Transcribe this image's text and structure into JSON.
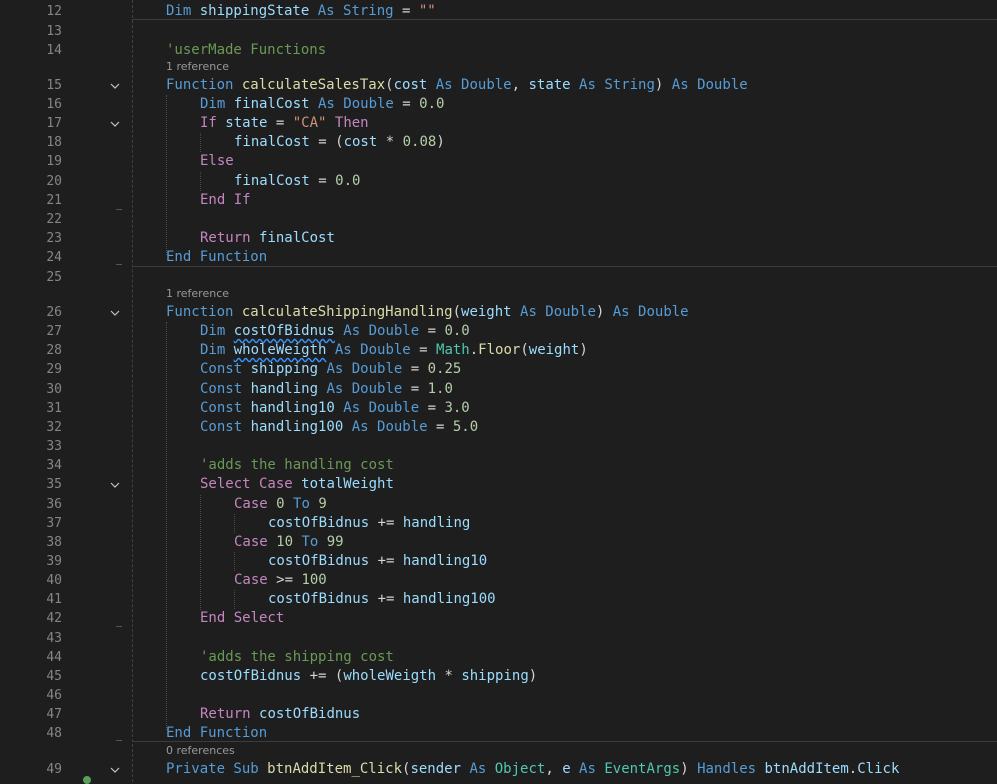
{
  "editor": {
    "colors": {
      "background": "#1e1e1e",
      "line_number": "#858585",
      "keyword": "#569cd6",
      "control": "#c586c0",
      "function": "#dcdcaa",
      "variable": "#9cdcfe",
      "string": "#ce9178",
      "number": "#b5cea8",
      "comment": "#6a9955",
      "type": "#4ec9b0"
    },
    "lenses": {
      "l15": "1 reference",
      "l26": "1 reference",
      "l49": "0 references"
    },
    "fold_icon": "chevron-down-icon",
    "lines": [
      {
        "n": "12",
        "tokens": [
          {
            "c": "kw",
            "t": "Dim "
          },
          {
            "c": "var",
            "t": "shippingState"
          },
          {
            "c": "kw",
            "t": " As String "
          },
          {
            "c": "",
            "t": "= "
          },
          {
            "c": "str",
            "t": "\"\""
          }
        ]
      },
      {
        "n": "13",
        "tokens": []
      },
      {
        "n": "14",
        "tokens": [
          {
            "c": "com",
            "t": "'userMade Functions"
          }
        ]
      },
      {
        "n": "15",
        "tokens": [
          {
            "c": "kw",
            "t": "Function "
          },
          {
            "c": "fn",
            "t": "calculateSalesTax"
          },
          {
            "c": "",
            "t": "("
          },
          {
            "c": "var",
            "t": "cost"
          },
          {
            "c": "kw",
            "t": " As Double"
          },
          {
            "c": "",
            "t": ", "
          },
          {
            "c": "var",
            "t": "state"
          },
          {
            "c": "kw",
            "t": " As String"
          },
          {
            "c": "",
            "t": ") "
          },
          {
            "c": "kw",
            "t": "As Double"
          }
        ]
      },
      {
        "n": "16",
        "tokens": [
          {
            "c": "kw",
            "t": "Dim "
          },
          {
            "c": "var",
            "t": "finalCost"
          },
          {
            "c": "kw",
            "t": " As Double "
          },
          {
            "c": "",
            "t": "= "
          },
          {
            "c": "num",
            "t": "0.0"
          }
        ]
      },
      {
        "n": "17",
        "tokens": [
          {
            "c": "ctl",
            "t": "If "
          },
          {
            "c": "var",
            "t": "state"
          },
          {
            "c": "",
            "t": " = "
          },
          {
            "c": "str",
            "t": "\"CA\""
          },
          {
            "c": "ctl",
            "t": " Then"
          }
        ]
      },
      {
        "n": "18",
        "tokens": [
          {
            "c": "var",
            "t": "finalCost"
          },
          {
            "c": "",
            "t": " = ("
          },
          {
            "c": "var",
            "t": "cost"
          },
          {
            "c": "",
            "t": " * "
          },
          {
            "c": "num",
            "t": "0.08"
          },
          {
            "c": "",
            "t": ")"
          }
        ]
      },
      {
        "n": "19",
        "tokens": [
          {
            "c": "ctl",
            "t": "Else"
          }
        ]
      },
      {
        "n": "20",
        "tokens": [
          {
            "c": "var",
            "t": "finalCost"
          },
          {
            "c": "",
            "t": " = "
          },
          {
            "c": "num",
            "t": "0.0"
          }
        ]
      },
      {
        "n": "21",
        "tokens": [
          {
            "c": "ctl",
            "t": "End If"
          }
        ]
      },
      {
        "n": "22",
        "tokens": []
      },
      {
        "n": "23",
        "tokens": [
          {
            "c": "ctl",
            "t": "Return "
          },
          {
            "c": "var",
            "t": "finalCost"
          }
        ]
      },
      {
        "n": "24",
        "tokens": [
          {
            "c": "kw",
            "t": "End Function"
          }
        ]
      },
      {
        "n": "25",
        "tokens": []
      },
      {
        "n": "26",
        "tokens": [
          {
            "c": "kw",
            "t": "Function "
          },
          {
            "c": "fn",
            "t": "calculateShippingHandling"
          },
          {
            "c": "",
            "t": "("
          },
          {
            "c": "var",
            "t": "weight"
          },
          {
            "c": "kw",
            "t": " As Double"
          },
          {
            "c": "",
            "t": ") "
          },
          {
            "c": "kw",
            "t": "As Double"
          }
        ]
      },
      {
        "n": "27",
        "tokens": [
          {
            "c": "kw",
            "t": "Dim "
          },
          {
            "c": "var sq",
            "t": "costOfBidnus"
          },
          {
            "c": "kw",
            "t": " As Double "
          },
          {
            "c": "",
            "t": "= "
          },
          {
            "c": "num",
            "t": "0.0"
          }
        ]
      },
      {
        "n": "28",
        "tokens": [
          {
            "c": "kw",
            "t": "Dim "
          },
          {
            "c": "var sq",
            "t": "wholeWeigth"
          },
          {
            "c": "kw",
            "t": " As Double "
          },
          {
            "c": "",
            "t": "= "
          },
          {
            "c": "cls",
            "t": "Math"
          },
          {
            "c": "",
            "t": "."
          },
          {
            "c": "fn",
            "t": "Floor"
          },
          {
            "c": "",
            "t": "("
          },
          {
            "c": "var",
            "t": "weight"
          },
          {
            "c": "",
            "t": ")"
          }
        ]
      },
      {
        "n": "29",
        "tokens": [
          {
            "c": "kw",
            "t": "Const "
          },
          {
            "c": "var",
            "t": "shipping"
          },
          {
            "c": "kw",
            "t": " As Double "
          },
          {
            "c": "",
            "t": "= "
          },
          {
            "c": "num",
            "t": "0.25"
          }
        ]
      },
      {
        "n": "30",
        "tokens": [
          {
            "c": "kw",
            "t": "Const "
          },
          {
            "c": "var",
            "t": "handling"
          },
          {
            "c": "kw",
            "t": " As Double "
          },
          {
            "c": "",
            "t": "= "
          },
          {
            "c": "num",
            "t": "1.0"
          }
        ]
      },
      {
        "n": "31",
        "tokens": [
          {
            "c": "kw",
            "t": "Const "
          },
          {
            "c": "var",
            "t": "handling10"
          },
          {
            "c": "kw",
            "t": " As Double "
          },
          {
            "c": "",
            "t": "= "
          },
          {
            "c": "num",
            "t": "3.0"
          }
        ]
      },
      {
        "n": "32",
        "tokens": [
          {
            "c": "kw",
            "t": "Const "
          },
          {
            "c": "var",
            "t": "handling100"
          },
          {
            "c": "kw",
            "t": " As Double "
          },
          {
            "c": "",
            "t": "= "
          },
          {
            "c": "num",
            "t": "5.0"
          }
        ]
      },
      {
        "n": "33",
        "tokens": []
      },
      {
        "n": "34",
        "tokens": [
          {
            "c": "com",
            "t": "'adds the handling cost"
          }
        ]
      },
      {
        "n": "35",
        "tokens": [
          {
            "c": "ctl",
            "t": "Select Case "
          },
          {
            "c": "var",
            "t": "totalWeight"
          }
        ]
      },
      {
        "n": "36",
        "tokens": [
          {
            "c": "ctl",
            "t": "Case "
          },
          {
            "c": "num",
            "t": "0"
          },
          {
            "c": "kw",
            "t": " To "
          },
          {
            "c": "num",
            "t": "9"
          }
        ]
      },
      {
        "n": "37",
        "tokens": [
          {
            "c": "var",
            "t": "costOfBidnus"
          },
          {
            "c": "",
            "t": " += "
          },
          {
            "c": "var",
            "t": "handling"
          }
        ]
      },
      {
        "n": "38",
        "tokens": [
          {
            "c": "ctl",
            "t": "Case "
          },
          {
            "c": "num",
            "t": "10"
          },
          {
            "c": "kw",
            "t": " To "
          },
          {
            "c": "num",
            "t": "99"
          }
        ]
      },
      {
        "n": "39",
        "tokens": [
          {
            "c": "var",
            "t": "costOfBidnus"
          },
          {
            "c": "",
            "t": " += "
          },
          {
            "c": "var",
            "t": "handling10"
          }
        ]
      },
      {
        "n": "40",
        "tokens": [
          {
            "c": "ctl",
            "t": "Case "
          },
          {
            "c": "",
            "t": ">= "
          },
          {
            "c": "num",
            "t": "100"
          }
        ]
      },
      {
        "n": "41",
        "tokens": [
          {
            "c": "var",
            "t": "costOfBidnus"
          },
          {
            "c": "",
            "t": " += "
          },
          {
            "c": "var",
            "t": "handling100"
          }
        ]
      },
      {
        "n": "42",
        "tokens": [
          {
            "c": "ctl",
            "t": "End Select"
          }
        ]
      },
      {
        "n": "43",
        "tokens": []
      },
      {
        "n": "44",
        "tokens": [
          {
            "c": "com",
            "t": "'adds the shipping cost"
          }
        ]
      },
      {
        "n": "45",
        "tokens": [
          {
            "c": "var",
            "t": "costOfBidnus"
          },
          {
            "c": "",
            "t": " += ("
          },
          {
            "c": "var",
            "t": "wholeWeigth"
          },
          {
            "c": "",
            "t": " * "
          },
          {
            "c": "var",
            "t": "shipping"
          },
          {
            "c": "",
            "t": ")"
          }
        ]
      },
      {
        "n": "46",
        "tokens": []
      },
      {
        "n": "47",
        "tokens": [
          {
            "c": "ctl",
            "t": "Return "
          },
          {
            "c": "var",
            "t": "costOfBidnus"
          }
        ]
      },
      {
        "n": "48",
        "tokens": [
          {
            "c": "kw",
            "t": "End Function"
          }
        ]
      },
      {
        "n": "49",
        "tokens": [
          {
            "c": "kw",
            "t": "Private Sub "
          },
          {
            "c": "fn",
            "t": "btnAddItem_Click"
          },
          {
            "c": "",
            "t": "("
          },
          {
            "c": "var",
            "t": "sender"
          },
          {
            "c": "kw",
            "t": " As "
          },
          {
            "c": "cls",
            "t": "Object"
          },
          {
            "c": "",
            "t": ", "
          },
          {
            "c": "var",
            "t": "e"
          },
          {
            "c": "kw",
            "t": " As "
          },
          {
            "c": "cls",
            "t": "EventArgs"
          },
          {
            "c": "",
            "t": ") "
          },
          {
            "c": "kw",
            "t": "Handles "
          },
          {
            "c": "var",
            "t": "btnAddItem"
          },
          {
            "c": "",
            "t": "."
          },
          {
            "c": "var",
            "t": "Click"
          }
        ]
      }
    ]
  }
}
